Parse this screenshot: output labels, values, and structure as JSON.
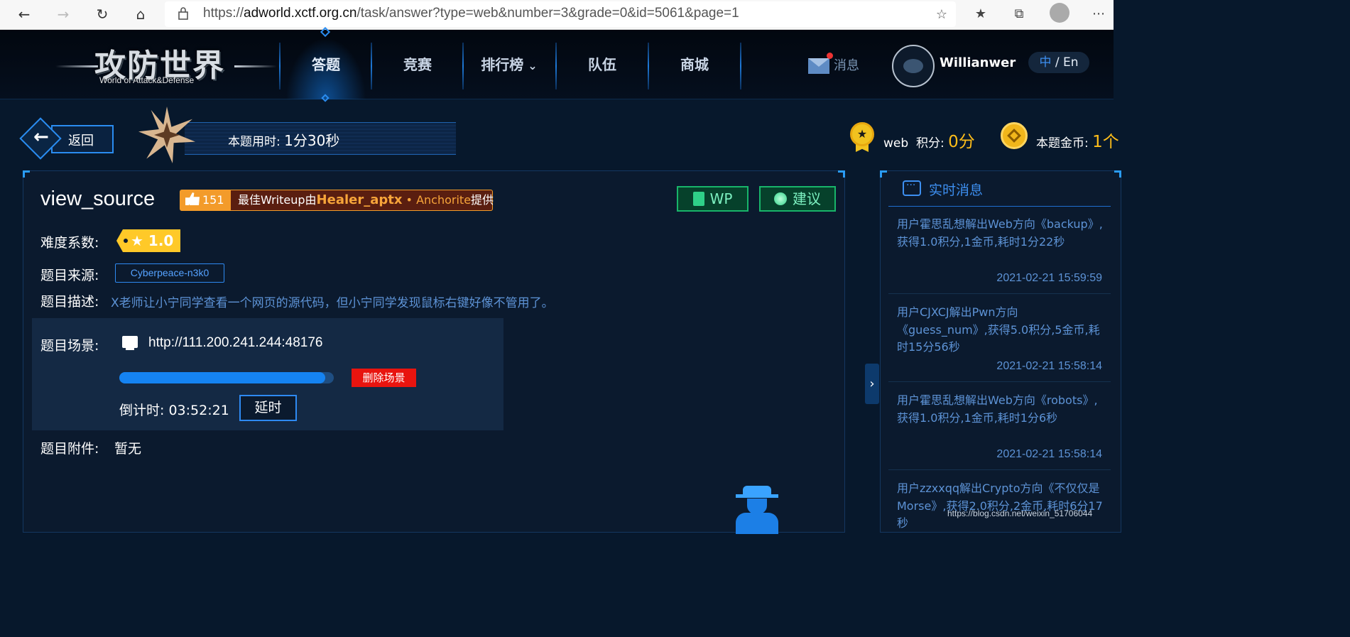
{
  "browser": {
    "url_prefix": "https://",
    "url_host": "adworld.xctf.org.cn",
    "url_path": "/task/answer?type=web&number=3&grade=0&id=5061&page=1"
  },
  "header": {
    "logo_text": "攻防世界",
    "logo_subtitle": "World of Attack&Defense",
    "nav": [
      "答题",
      "竞赛",
      "排行榜",
      "队伍",
      "商城"
    ],
    "active_nav": "答题",
    "messages_label": "消息",
    "username": "Willianwer",
    "lang_zh": "中",
    "lang_sep": " / ",
    "lang_en": "En"
  },
  "timer_strip": {
    "back_label": "返回",
    "time_label": "本题用时: ",
    "time_value": "1分30秒",
    "category": "web",
    "score_label": "积分: ",
    "score_value": "0分",
    "coin_label": "本题金币: ",
    "coin_value": "1个"
  },
  "task": {
    "title": "view_source",
    "likes": "151",
    "writeup_prefix": "最佳Writeup由",
    "writeup_author": "Healer_aptx",
    "writeup_sep": " • ",
    "writeup_team": "Anchorite",
    "writeup_suffix": "提供",
    "wp_label": "WP",
    "suggest_label": "建议",
    "difficulty_label": "难度系数:",
    "difficulty_value": "1.0",
    "source_label": "题目来源:",
    "source_value": "Cyberpeace-n3k0",
    "desc_label": "题目描述:",
    "desc_value": "X老师让小宁同学查看一个网页的源代码，但小宁同学发现鼠标右键好像不管用了。",
    "scene_label": "题目场景:",
    "scene_url": "http://111.200.241.244:48176",
    "scene_progress": 0.96,
    "delete_label": "删除场景",
    "countdown_label": "倒计时:",
    "countdown_value": "03:52:21",
    "delay_label": "延时",
    "attach_label": "题目附件:",
    "attach_value": "暂无"
  },
  "news": {
    "title": "实时消息",
    "items": [
      {
        "text": "用户霍思乱想解出Web方向《backup》,获得1.0积分,1金币,耗时1分22秒",
        "time": "2021-02-21 15:59:59"
      },
      {
        "text": "用户CJXCJ解出Pwn方向《guess_num》,获得5.0积分,5金币,耗时15分56秒",
        "time": "2021-02-21 15:58:14"
      },
      {
        "text": "用户霍思乱想解出Web方向《robots》,获得1.0积分,1金币,耗时1分6秒",
        "time": "2021-02-21 15:58:14"
      },
      {
        "text": "用户zzxxqq解出Crypto方向《不仅仅是Morse》,获得2.0积分,2金币,耗时6分17秒",
        "time": ""
      }
    ]
  },
  "watermark": "https://blog.csdn.net/weixin_51706044",
  "colors": {
    "accent": "#2a8cf0",
    "gold": "#ffbe1a",
    "danger": "#e8140f",
    "wp_green": "#18b56a"
  }
}
